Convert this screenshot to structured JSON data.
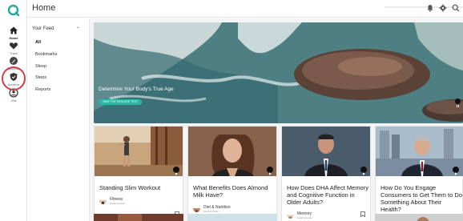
{
  "app": {
    "title": "Home",
    "brand_color": "#27a99a",
    "highlight_color": "#d43c4a"
  },
  "rail": {
    "items": [
      {
        "icon": "home-icon",
        "label": "Home"
      },
      {
        "icon": "heart-icon",
        "label": "Track"
      },
      {
        "icon": "pencil-icon",
        "label": "Discover"
      },
      {
        "icon": "shield-icon",
        "label": "Achieve"
      },
      {
        "icon": "person-icon",
        "label": "Vtal"
      }
    ]
  },
  "header": {
    "icons": [
      "bell-icon",
      "gear-icon",
      "search-icon"
    ]
  },
  "feed_nav": {
    "heading": "Your Feed",
    "items": [
      {
        "label": "All",
        "active": true
      },
      {
        "label": "Bookmarks"
      },
      {
        "label": "Sleep"
      },
      {
        "label": "Steps"
      },
      {
        "label": "Reports"
      }
    ]
  },
  "hero": {
    "title": "Determine Your Body's True Age",
    "button": "TAKE THE REALAGE TEST"
  },
  "cards": [
    {
      "title": "Standing Slim Workout",
      "category": "Fitness",
      "sub": "Good to know"
    },
    {
      "title": "What Benefits Does Almond Milk Have?",
      "category": "Diet & Nutrition",
      "sub": "Good to know"
    },
    {
      "title": "How Does DHA Affect Memory and Cognitive Function in Older Adults?",
      "category": "Memory",
      "sub": "Good to know"
    },
    {
      "title": "How Do You Engage Consumers to Get Them to Do Something About Their Health?",
      "category": "",
      "sub": ""
    }
  ]
}
